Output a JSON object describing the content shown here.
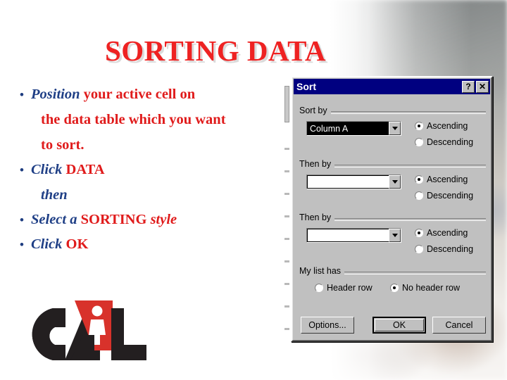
{
  "slide": {
    "title": "SORTING DATA",
    "bullets": [
      {
        "lead": "Position",
        "rest": " your active cell on"
      },
      {
        "lead": "Click",
        "rest": " DATA"
      },
      {
        "lead": "Select a",
        "rest": " SORTING",
        "tail_italic": " style"
      },
      {
        "lead": "Click",
        "rest": "  OK"
      }
    ],
    "continuation_lines": [
      "the data table which you want",
      "to sort.",
      "then"
    ],
    "bullet_glyph": "•",
    "colors": {
      "title_red": "#ee2222",
      "accent_blue": "#1f3f86",
      "body_red": "#e01b1b"
    },
    "logo": {
      "text": "CAL",
      "alt": "CAL logo"
    }
  },
  "dialog": {
    "title": "Sort",
    "help_button": "?",
    "close_button": "✕",
    "groups": {
      "sort_by": {
        "label": "Sort by",
        "combo_value": "Column A",
        "combo_selected": true,
        "options": [
          "Ascending",
          "Descending"
        ],
        "selected_option": "Ascending"
      },
      "then_by_1": {
        "label": "Then by",
        "combo_value": "",
        "combo_selected": false,
        "options": [
          "Ascending",
          "Descending"
        ],
        "selected_option": "Ascending"
      },
      "then_by_2": {
        "label": "Then by",
        "combo_value": "",
        "combo_selected": false,
        "options": [
          "Ascending",
          "Descending"
        ],
        "selected_option": "Ascending"
      },
      "my_list_has": {
        "label": "My list has",
        "options": [
          "Header row",
          "No header row"
        ],
        "selected_option": "No header row"
      }
    },
    "buttons": {
      "options": "Options...",
      "ok": "OK",
      "cancel": "Cancel"
    }
  }
}
